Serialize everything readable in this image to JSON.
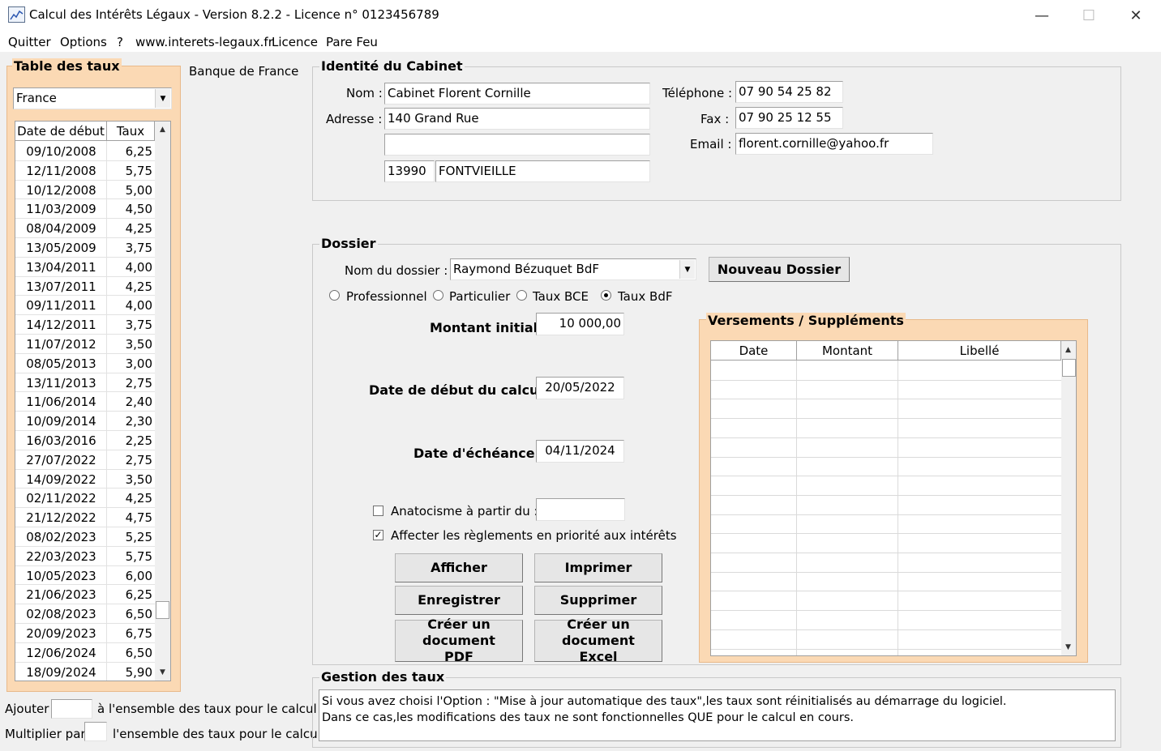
{
  "window": {
    "title": "Calcul des Intérêts Légaux - Version 8.2.2 - Licence n° 0123456789",
    "minimize": "—",
    "maximize": "☐",
    "close": "✕"
  },
  "menu": [
    "Quitter",
    "Options",
    "?",
    "www.interets-legaux.fr",
    "Licence",
    "Pare Feu"
  ],
  "rates": {
    "group_title": "Table des taux",
    "source_label": "Banque de France",
    "country": "France",
    "columns": [
      "Date de début",
      "Taux"
    ],
    "rows": [
      {
        "date": "09/10/2008",
        "taux": "6,25"
      },
      {
        "date": "12/11/2008",
        "taux": "5,75"
      },
      {
        "date": "10/12/2008",
        "taux": "5,00"
      },
      {
        "date": "11/03/2009",
        "taux": "4,50"
      },
      {
        "date": "08/04/2009",
        "taux": "4,25"
      },
      {
        "date": "13/05/2009",
        "taux": "3,75"
      },
      {
        "date": "13/04/2011",
        "taux": "4,00"
      },
      {
        "date": "13/07/2011",
        "taux": "4,25"
      },
      {
        "date": "09/11/2011",
        "taux": "4,00"
      },
      {
        "date": "14/12/2011",
        "taux": "3,75"
      },
      {
        "date": "11/07/2012",
        "taux": "3,50"
      },
      {
        "date": "08/05/2013",
        "taux": "3,00"
      },
      {
        "date": "13/11/2013",
        "taux": "2,75"
      },
      {
        "date": "11/06/2014",
        "taux": "2,40"
      },
      {
        "date": "10/09/2014",
        "taux": "2,30"
      },
      {
        "date": "16/03/2016",
        "taux": "2,25"
      },
      {
        "date": "27/07/2022",
        "taux": "2,75"
      },
      {
        "date": "14/09/2022",
        "taux": "3,50"
      },
      {
        "date": "02/11/2022",
        "taux": "4,25"
      },
      {
        "date": "21/12/2022",
        "taux": "4,75"
      },
      {
        "date": "08/02/2023",
        "taux": "5,25"
      },
      {
        "date": "22/03/2023",
        "taux": "5,75"
      },
      {
        "date": "10/05/2023",
        "taux": "6,00"
      },
      {
        "date": "21/06/2023",
        "taux": "6,25"
      },
      {
        "date": "02/08/2023",
        "taux": "6,50"
      },
      {
        "date": "20/09/2023",
        "taux": "6,75"
      },
      {
        "date": "12/06/2024",
        "taux": "6,50"
      },
      {
        "date": "18/09/2024",
        "taux": "5,90"
      }
    ],
    "add_prefix": "Ajouter",
    "add_suffix": "à l'ensemble des taux pour le calcul",
    "mult_prefix": "Multiplier par",
    "mult_suffix": "l'ensemble des taux pour le calcul"
  },
  "cabinet": {
    "group_title": "Identité du Cabinet",
    "nom_label": "Nom :",
    "nom": "Cabinet Florent Cornille",
    "adresse_label": "Adresse :",
    "adresse1": "140 Grand Rue",
    "adresse2": "",
    "cp": "13990",
    "ville": "FONTVIEILLE",
    "tel_label": "Téléphone :",
    "tel": "07 90 54 25 82",
    "fax_label": "Fax :",
    "fax": "07 90 25 12 55",
    "email_label": "Email :",
    "email": "florent.cornille@yahoo.fr"
  },
  "dossier": {
    "group_title": "Dossier",
    "nom_label": "Nom du dossier :",
    "nom": "Raymond Bézuquet BdF",
    "new_button": "Nouveau Dossier",
    "radios": [
      "Professionnel",
      "Particulier",
      "Taux BCE",
      "Taux BdF"
    ],
    "selected_radio": "Taux BdF",
    "montant_label": "Montant initial :",
    "montant": "10 000,00",
    "date_debut_label": "Date de début du calcul :",
    "date_debut": "20/05/2022",
    "echeance_label": "Date d'échéance :",
    "echeance": "04/11/2024",
    "anatocisme_label": "Anatocisme à partir du :",
    "anatocisme_checked": false,
    "anatocisme_date": "",
    "affecter_label": "Affecter les règlements en priorité aux intérêts",
    "affecter_checked": true,
    "buttons": {
      "afficher": "Afficher",
      "imprimer": "Imprimer",
      "enregistrer": "Enregistrer",
      "supprimer": "Supprimer",
      "pdf": "Créer un document PDF",
      "excel": "Créer un document Excel"
    }
  },
  "versements": {
    "group_title": "Versements / Suppléments",
    "columns": [
      "Date",
      "Montant",
      "Libellé"
    ]
  },
  "gestion": {
    "group_title": "Gestion des taux",
    "line1": "Si vous avez choisi l'Option : \"Mise à jour automatique des taux\",les taux sont réinitialisés au démarrage du logiciel.",
    "line2": "Dans ce cas,les modifications des taux ne sont fonctionnelles QUE pour le calcul en cours."
  }
}
